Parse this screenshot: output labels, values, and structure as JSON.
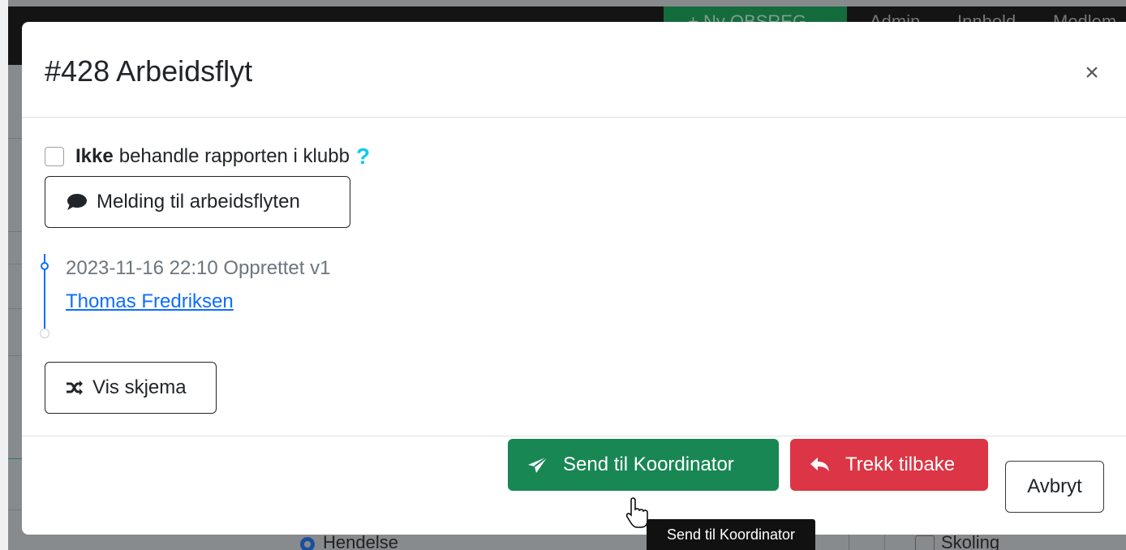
{
  "background": {
    "nav_new_label": "+ Ny OBSREG",
    "nav_items": [
      "Admin",
      "Innhold",
      "Medlem"
    ],
    "bottom_items": [
      "Hendelse",
      "Skoling"
    ]
  },
  "modal": {
    "title": "#428 Arbeidsflyt",
    "close_symbol": "×",
    "checkbox": {
      "checked": false,
      "bold_text": "Ikke",
      "rest_text": "behandle rapporten i klubb",
      "help_symbol": "?"
    },
    "message_button": {
      "label": "Melding til arbeidsflyten",
      "icon": "comment-icon"
    },
    "timeline": [
      {
        "datetime": "2023-11-16 22:10",
        "event": "Opprettet v1",
        "user": "Thomas Fredriksen"
      }
    ],
    "schema_button": {
      "label": "Vis skjema",
      "icon": "shuffle-icon"
    },
    "footer": {
      "send": {
        "label": "Send til Koordinator",
        "icon": "paper-plane-icon",
        "color": "#198754"
      },
      "revoke": {
        "label": "Trekk tilbake",
        "icon": "reply-icon",
        "color": "#dc3545"
      },
      "cancel": {
        "label": "Avbryt"
      }
    }
  },
  "tooltip": {
    "text": "Send til Koordinator"
  }
}
